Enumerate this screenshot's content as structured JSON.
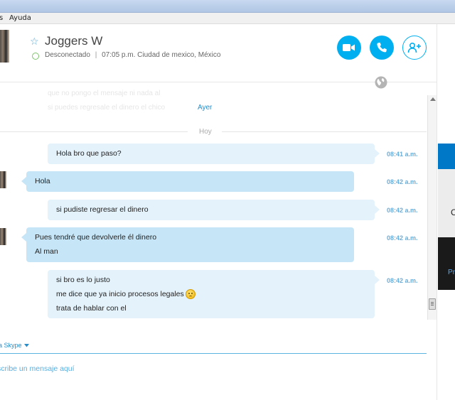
{
  "menu": {
    "items": [
      "s",
      "Ayuda"
    ]
  },
  "header": {
    "contact_name": "Joggers W",
    "status": "Desconectado",
    "status_separator": "|",
    "local_time": "07:05 p.m. Ciudad de mexico, México"
  },
  "history": {
    "faded_lines": [
      "que no pongo el mensaje ni nada al",
      "si puedes regresale el dinero el chico"
    ],
    "previous_day_label": "Ayer",
    "today_label": "Hoy"
  },
  "messages": [
    {
      "direction": "out",
      "lines": [
        "Hola bro que paso?"
      ],
      "time": "08:41 a.m."
    },
    {
      "direction": "in",
      "lines": [
        "Hola"
      ],
      "time": "08:42 a.m."
    },
    {
      "direction": "out",
      "lines": [
        "si pudiste regresar el dinero"
      ],
      "time": "08:42 a.m."
    },
    {
      "direction": "in",
      "lines": [
        "Pues tendré que devolverle él dinero",
        "Al man"
      ],
      "time": "08:42 a.m."
    },
    {
      "direction": "out",
      "lines": [
        "si bro es lo justo",
        "me dice que ya inicio procesos legales",
        "trata de hablar con el"
      ],
      "time": "08:42 a.m."
    }
  ],
  "ad": {
    "letter": "C",
    "dark_text": "Pr"
  },
  "compose": {
    "via_label": "a Skype",
    "placeholder": "scribe un mensaje aquí"
  },
  "colors": {
    "accent": "#00aff0",
    "bubble_out": "#e3f2fb",
    "bubble_in": "#c6e6f7",
    "online_ring": "#7dc36b"
  },
  "icons": [
    "star-icon",
    "video-call-icon",
    "phone-call-icon",
    "add-contact-icon",
    "globe-icon",
    "sad-emoticon-icon",
    "chevron-down-icon"
  ]
}
